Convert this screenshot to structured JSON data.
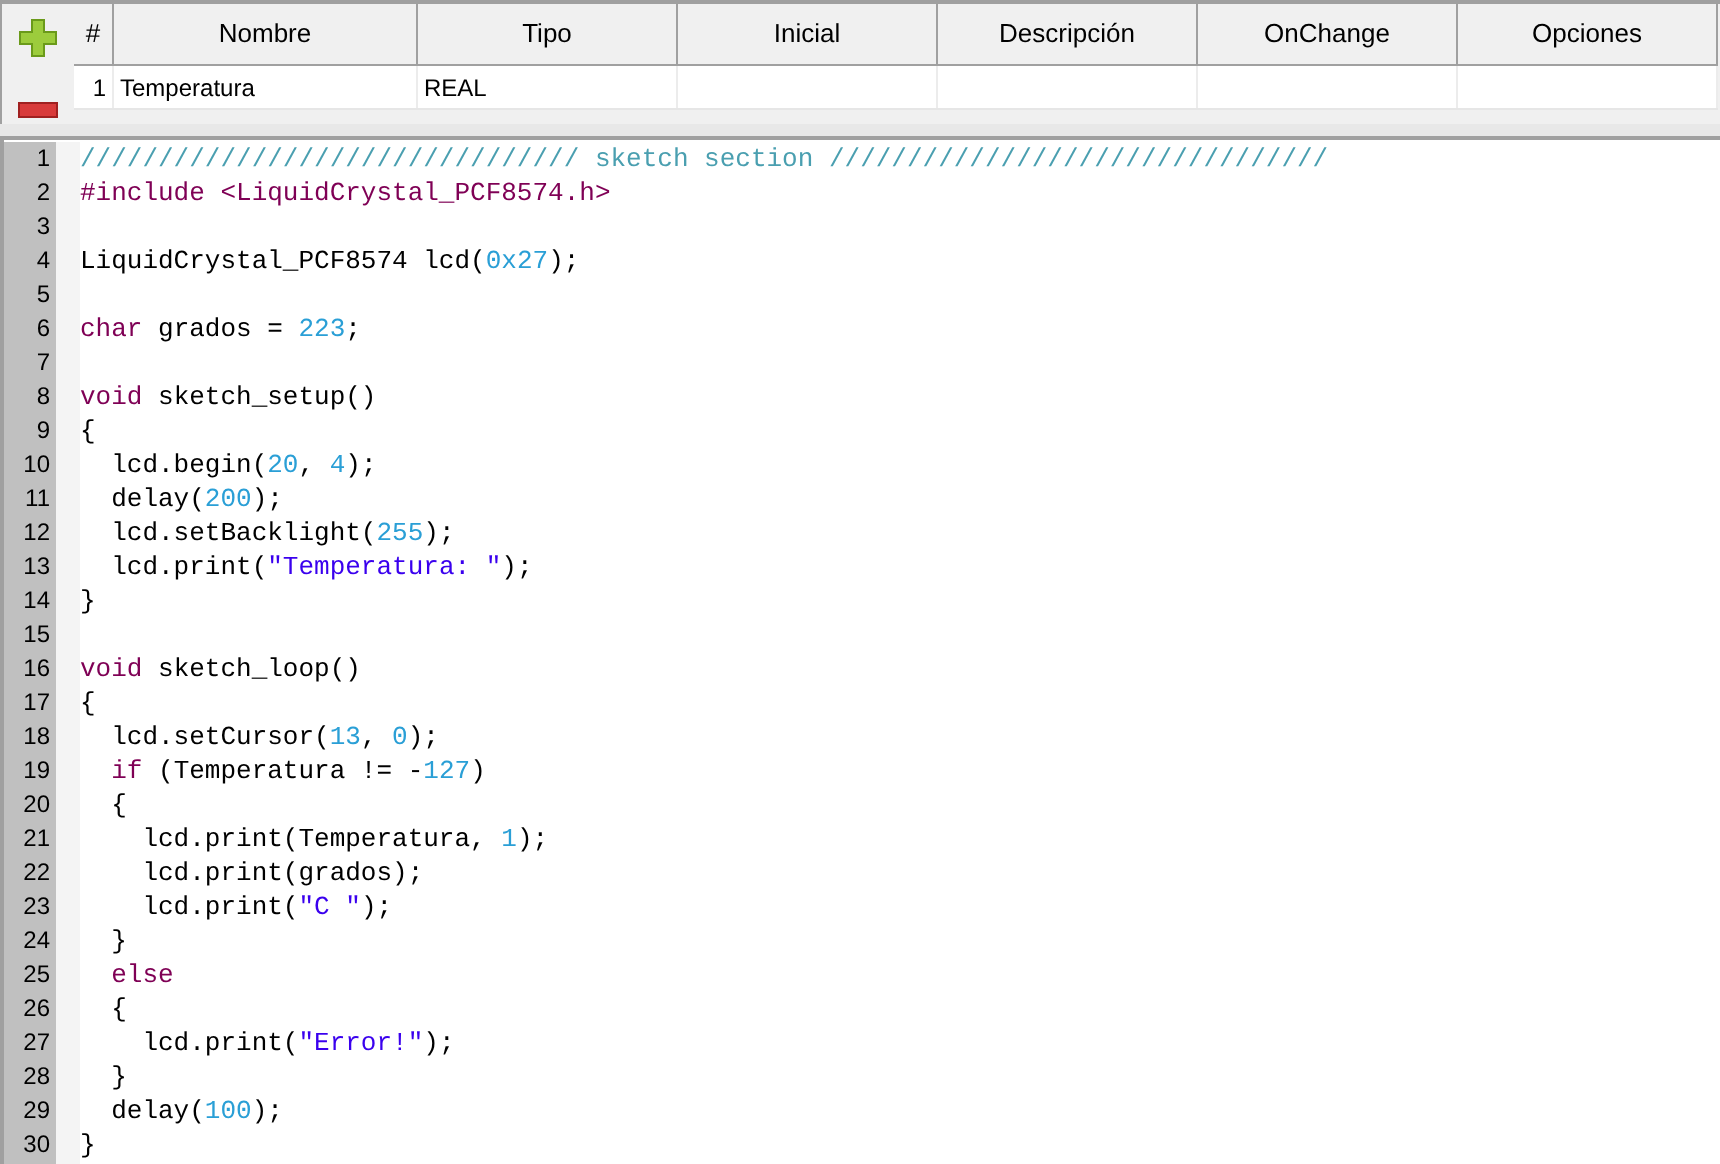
{
  "variables_table": {
    "columns": [
      "#",
      "Nombre",
      "Tipo",
      "Inicial",
      "Descripción",
      "OnChange",
      "Opciones"
    ],
    "rows": [
      {
        "cells": [
          "1",
          "Temperatura",
          "REAL",
          "",
          "",
          "",
          ""
        ]
      }
    ]
  },
  "editor": {
    "lines": [
      {
        "number": "1",
        "tokens": [
          {
            "kind": "comment",
            "text": "//////////////////////////////// sketch section ////////////////////////////////"
          }
        ]
      },
      {
        "number": "2",
        "tokens": [
          {
            "kind": "directive",
            "text": "#include <LiquidCrystal_PCF8574.h>"
          }
        ]
      },
      {
        "number": "3"
      },
      {
        "number": "4",
        "tokens": [
          {
            "kind": "plain",
            "text": "LiquidCrystal_PCF8574 lcd("
          },
          {
            "kind": "number",
            "text": "0x27"
          },
          {
            "kind": "plain",
            "text": ");"
          }
        ]
      },
      {
        "number": "5"
      },
      {
        "number": "6",
        "tokens": [
          {
            "kind": "keyword",
            "text": "char"
          },
          {
            "kind": "plain",
            "text": " grados = "
          },
          {
            "kind": "number",
            "text": "223"
          },
          {
            "kind": "plain",
            "text": ";"
          }
        ]
      },
      {
        "number": "7"
      },
      {
        "number": "8",
        "tokens": [
          {
            "kind": "keyword",
            "text": "void"
          },
          {
            "kind": "plain",
            "text": " sketch_setup()"
          }
        ]
      },
      {
        "number": "9",
        "tokens": [
          {
            "kind": "plain",
            "text": "{"
          }
        ]
      },
      {
        "number": "10",
        "tokens": [
          {
            "kind": "plain",
            "text": "  lcd.begin("
          },
          {
            "kind": "number",
            "text": "20"
          },
          {
            "kind": "plain",
            "text": ", "
          },
          {
            "kind": "number",
            "text": "4"
          },
          {
            "kind": "plain",
            "text": ");"
          }
        ]
      },
      {
        "number": "11",
        "tokens": [
          {
            "kind": "plain",
            "text": "  delay("
          },
          {
            "kind": "number",
            "text": "200"
          },
          {
            "kind": "plain",
            "text": ");"
          }
        ]
      },
      {
        "number": "12",
        "tokens": [
          {
            "kind": "plain",
            "text": "  lcd.setBacklight("
          },
          {
            "kind": "number",
            "text": "255"
          },
          {
            "kind": "plain",
            "text": ");"
          }
        ]
      },
      {
        "number": "13",
        "tokens": [
          {
            "kind": "plain",
            "text": "  lcd.print("
          },
          {
            "kind": "string",
            "text": "\"Temperatura: \""
          },
          {
            "kind": "plain",
            "text": ");"
          }
        ]
      },
      {
        "number": "14",
        "tokens": [
          {
            "kind": "plain",
            "text": "}"
          }
        ]
      },
      {
        "number": "15"
      },
      {
        "number": "16",
        "tokens": [
          {
            "kind": "keyword",
            "text": "void"
          },
          {
            "kind": "plain",
            "text": " sketch_loop()"
          }
        ]
      },
      {
        "number": "17",
        "tokens": [
          {
            "kind": "plain",
            "text": "{"
          }
        ]
      },
      {
        "number": "18",
        "tokens": [
          {
            "kind": "plain",
            "text": "  lcd.setCursor("
          },
          {
            "kind": "number",
            "text": "13"
          },
          {
            "kind": "plain",
            "text": ", "
          },
          {
            "kind": "number",
            "text": "0"
          },
          {
            "kind": "plain",
            "text": ");"
          }
        ]
      },
      {
        "number": "19",
        "tokens": [
          {
            "kind": "keyword",
            "text": "  if"
          },
          {
            "kind": "plain",
            "text": " (Temperatura != -"
          },
          {
            "kind": "number",
            "text": "127"
          },
          {
            "kind": "plain",
            "text": ")"
          }
        ]
      },
      {
        "number": "20",
        "tokens": [
          {
            "kind": "plain",
            "text": "  {"
          }
        ]
      },
      {
        "number": "21",
        "tokens": [
          {
            "kind": "plain",
            "text": "    lcd.print(Temperatura, "
          },
          {
            "kind": "number",
            "text": "1"
          },
          {
            "kind": "plain",
            "text": ");"
          }
        ]
      },
      {
        "number": "22",
        "tokens": [
          {
            "kind": "plain",
            "text": "    lcd.print(grados);"
          }
        ]
      },
      {
        "number": "23",
        "tokens": [
          {
            "kind": "plain",
            "text": "    lcd.print("
          },
          {
            "kind": "string",
            "text": "\"C \""
          },
          {
            "kind": "plain",
            "text": ");"
          }
        ]
      },
      {
        "number": "24",
        "tokens": [
          {
            "kind": "plain",
            "text": "  }"
          }
        ]
      },
      {
        "number": "25",
        "tokens": [
          {
            "kind": "keyword",
            "text": "  else"
          }
        ]
      },
      {
        "number": "26",
        "tokens": [
          {
            "kind": "plain",
            "text": "  {"
          }
        ]
      },
      {
        "number": "27",
        "tokens": [
          {
            "kind": "plain",
            "text": "    lcd.print("
          },
          {
            "kind": "string",
            "text": "\"Error!\""
          },
          {
            "kind": "plain",
            "text": ");"
          }
        ]
      },
      {
        "number": "28",
        "tokens": [
          {
            "kind": "plain",
            "text": "  }"
          }
        ]
      },
      {
        "number": "29",
        "tokens": [
          {
            "kind": "plain",
            "text": "  delay("
          },
          {
            "kind": "number",
            "text": "100"
          },
          {
            "kind": "plain",
            "text": ");"
          }
        ]
      },
      {
        "number": "30",
        "tokens": [
          {
            "kind": "plain",
            "text": "}"
          }
        ]
      }
    ]
  }
}
